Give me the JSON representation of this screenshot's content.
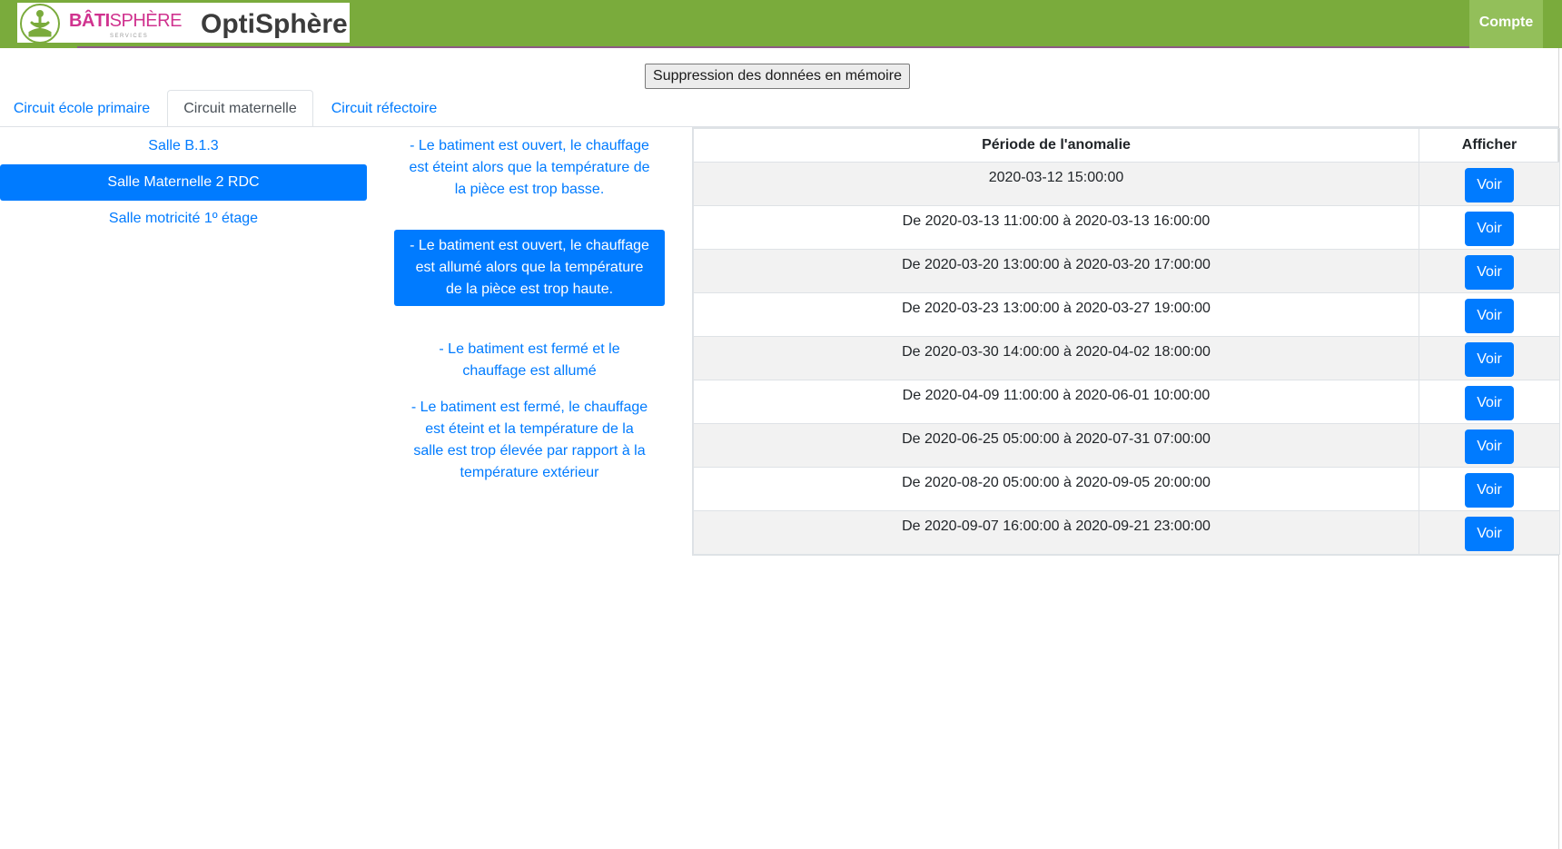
{
  "header": {
    "logo_brand_strong": "BÂTI",
    "logo_brand_rest": "SPHÈRE",
    "logo_tagline": "SERVICES",
    "app_name": "OptiSphère",
    "account_label": "Compte"
  },
  "clear_memory_label": "Suppression des données en mémoire",
  "tabs": [
    {
      "label": "Circuit école primaire",
      "active": false
    },
    {
      "label": "Circuit maternelle",
      "active": true
    },
    {
      "label": "Circuit réfectoire",
      "active": false
    }
  ],
  "rooms": [
    {
      "label": "Salle B.1.3",
      "active": false
    },
    {
      "label": "Salle Maternelle 2 RDC",
      "active": true
    },
    {
      "label": "Salle motricité 1º étage",
      "active": false
    }
  ],
  "anomaly_types": [
    {
      "label": "- Le batiment est ouvert, le chauffage est éteint alors que la température de la pièce est trop basse.",
      "active": false
    },
    {
      "label": "- Le batiment est ouvert, le chauffage est allumé alors que la température de la pièce est trop haute.",
      "active": true
    },
    {
      "label": "- Le batiment est fermé et le chauffage est allumé",
      "active": false
    },
    {
      "label": "- Le batiment est fermé, le chauffage est éteint et la température de la salle est trop élevée par rapport à la température extérieur",
      "active": false
    }
  ],
  "table": {
    "headers": {
      "period": "Période de l'anomalie",
      "action": "Afficher"
    },
    "rows": [
      {
        "period": "2020-03-12 15:00:00",
        "action": "Voir"
      },
      {
        "period": "De 2020-03-13 11:00:00 à 2020-03-13 16:00:00",
        "action": "Voir"
      },
      {
        "period": "De 2020-03-20 13:00:00 à 2020-03-20 17:00:00",
        "action": "Voir"
      },
      {
        "period": "De 2020-03-23 13:00:00 à 2020-03-27 19:00:00",
        "action": "Voir"
      },
      {
        "period": "De 2020-03-30 14:00:00 à 2020-04-02 18:00:00",
        "action": "Voir"
      },
      {
        "period": "De 2020-04-09 11:00:00 à 2020-06-01 10:00:00",
        "action": "Voir"
      },
      {
        "period": "De 2020-06-25 05:00:00 à 2020-07-31 07:00:00",
        "action": "Voir"
      },
      {
        "period": "De 2020-08-20 05:00:00 à 2020-09-05 20:00:00",
        "action": "Voir"
      },
      {
        "period": "De 2020-09-07 16:00:00 à 2020-09-21 23:00:00",
        "action": "Voir"
      }
    ]
  },
  "colors": {
    "header_green": "#7aab3c",
    "account_green": "#93bf5a",
    "primary_blue": "#007bff",
    "logo_pink": "#d0338f"
  },
  "icons": {
    "logo_emblem": "meditating-figure-logo-icon"
  }
}
